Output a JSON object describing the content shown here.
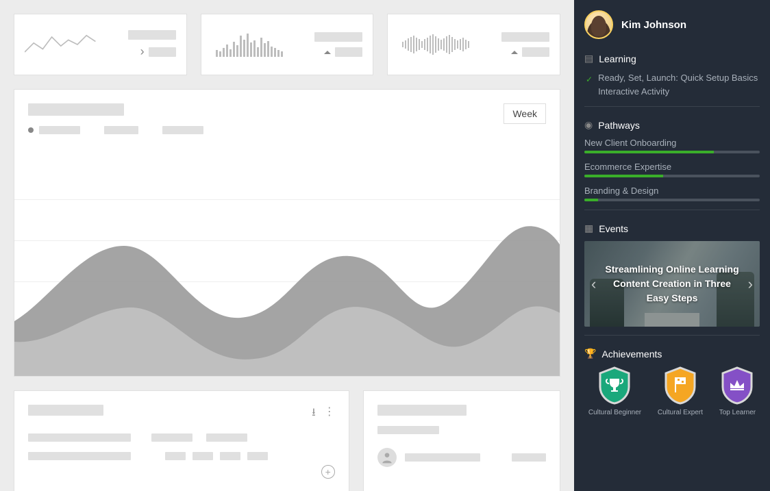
{
  "topStats": [
    {
      "spark": "line",
      "trend": "right"
    },
    {
      "spark": "bars",
      "trend": "up"
    },
    {
      "spark": "bars2",
      "trend": "up"
    }
  ],
  "mainChart": {
    "rangeLabel": "Week"
  },
  "sidebar": {
    "user": {
      "name": "Kim Johnson"
    },
    "learning": {
      "title": "Learning",
      "item": "Ready, Set, Launch: Quick Setup Basics Interactive Activity"
    },
    "pathways": {
      "title": "Pathways",
      "items": [
        {
          "label": "New Client Onboarding",
          "pct": 74
        },
        {
          "label": "Ecommerce Expertise",
          "pct": 45
        },
        {
          "label": "Branding & Design",
          "pct": 8
        }
      ]
    },
    "events": {
      "title": "Events",
      "featured": "Streamlining Online Learning Content Creation in Three Easy Steps"
    },
    "achievements": {
      "title": "Achievements",
      "items": [
        {
          "label": "Cultural Beginner",
          "color": "#1aa87b",
          "icon": "trophy"
        },
        {
          "label": "Cultural Expert",
          "color": "#f5a623",
          "icon": "flag"
        },
        {
          "label": "Top Learner",
          "color": "#8450c6",
          "icon": "crown"
        }
      ]
    }
  }
}
